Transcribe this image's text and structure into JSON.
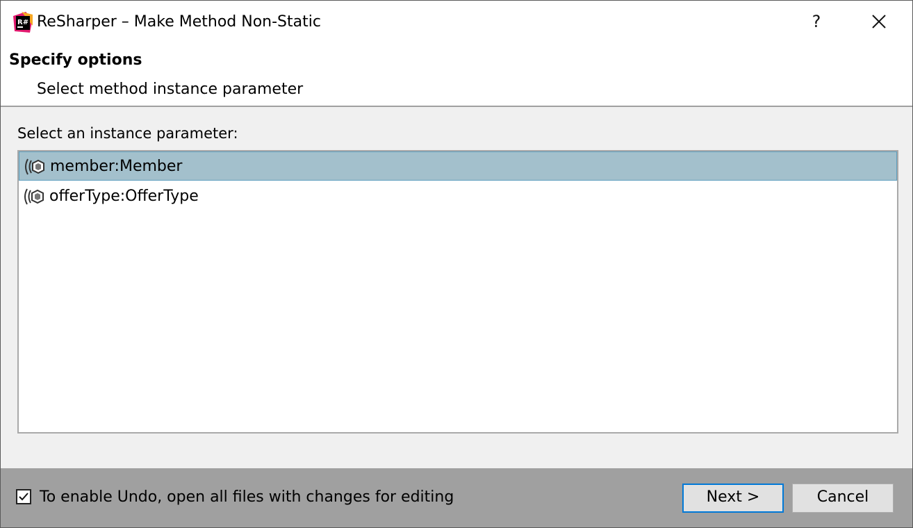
{
  "window": {
    "title": "ReSharper – Make Method Non-Static",
    "app_icon_text": "R#",
    "help_label": "?",
    "accent_colors": {
      "selection": "#a3c0cc",
      "focus": "#0078d7",
      "footer": "#a0a0a0"
    }
  },
  "header": {
    "title": "Specify options",
    "subtitle": "Select method instance parameter"
  },
  "main": {
    "list_label": "Select an instance parameter:",
    "items": [
      {
        "label": "member:Member",
        "icon": "parameter-icon",
        "selected": true
      },
      {
        "label": "offerType:OfferType",
        "icon": "parameter-icon",
        "selected": false
      }
    ]
  },
  "footer": {
    "undo_checkbox_label": "To enable Undo, open all files with changes for editing",
    "undo_checked": true,
    "next_label": "Next >",
    "cancel_label": "Cancel"
  }
}
